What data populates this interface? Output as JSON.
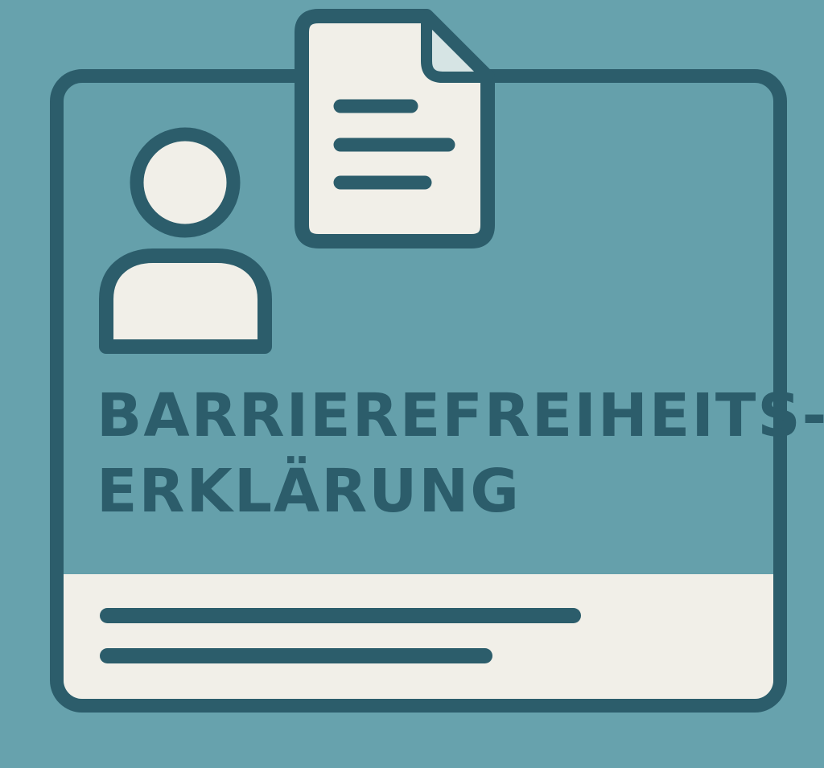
{
  "colors": {
    "background": "#67a2ad",
    "card_fill": "#65a0ab",
    "outline": "#2c5d6b",
    "paper": "#f1efe8",
    "fold": "#d6e4e4"
  },
  "icons": {
    "person": "person-icon",
    "document": "document-icon"
  },
  "title": {
    "line1": "BARRIEREFREIHEITS-",
    "line2": "ERKLÄRUNG"
  }
}
